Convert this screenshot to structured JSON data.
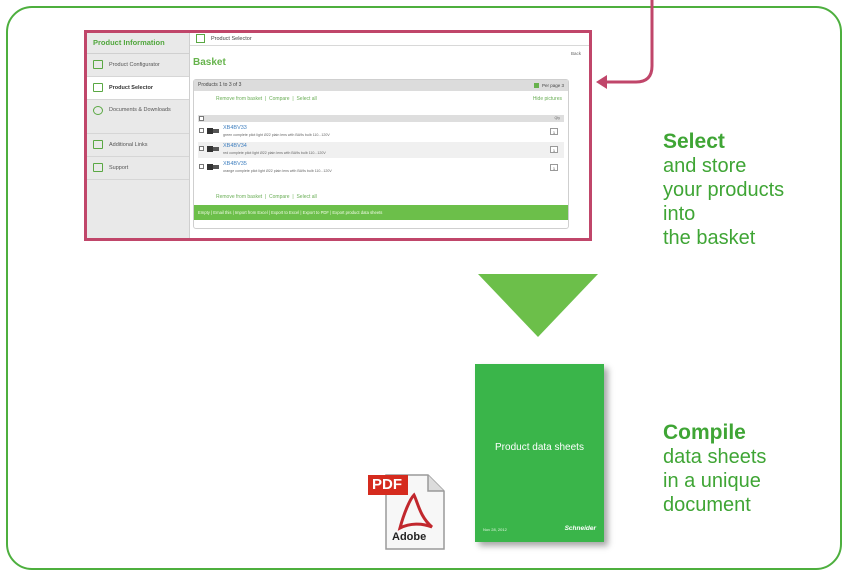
{
  "screenshot": {
    "sidebar": {
      "header": "Product Information",
      "items": [
        {
          "label": "Product Configurator"
        },
        {
          "label": "Product Selector"
        },
        {
          "label": "Documents & Downloads"
        },
        {
          "label": "Additional Links"
        },
        {
          "label": "Support"
        }
      ]
    },
    "topbar_title": "Product Selector",
    "back": "Back",
    "basket_title": "Basket",
    "products_count": "Products 1 to 3 of 3",
    "per_page": "Per page",
    "per_page_value": "3",
    "actions": {
      "remove": "Remove from basket",
      "compare": "Compare",
      "select_all": "Select all",
      "hide_pictures": "Hide pictures",
      "sep": "|"
    },
    "qty_header": "Qty",
    "rows": [
      {
        "code": "XB4BV33",
        "desc": "green complete pilot light Ø22 plain lens with BA9s bulb 110...120V",
        "qty": "1"
      },
      {
        "code": "XB4BV34",
        "desc": "red complete pilot light Ø22 plain lens with BA9s bulb 110...120V",
        "qty": "1"
      },
      {
        "code": "XB4BV35",
        "desc": "orange complete pilot light Ø22 plain lens with BA9s bulb 110...120V",
        "qty": "1"
      }
    ],
    "footer_bar": "Empty   |   Email this   |   Import from Excel   |   Export to Excel   |   Export to PDF   |   Export product data sheets"
  },
  "select": {
    "bold": "Select",
    "l1": "and store",
    "l2": "your products",
    "l3": "into",
    "l4": "the basket"
  },
  "compile": {
    "bold": "Compile",
    "l1": "data sheets",
    "l2": "in a unique",
    "l3": "document"
  },
  "cover": {
    "title": "Product data sheets",
    "date": "Nov 28, 2012",
    "brand": "Schneider"
  },
  "pdf_icon": {
    "tag": "PDF",
    "brand": "Adobe"
  },
  "colors": {
    "green": "#3fa535",
    "frame": "#c0466a",
    "arrow": "#6cbf4a"
  }
}
